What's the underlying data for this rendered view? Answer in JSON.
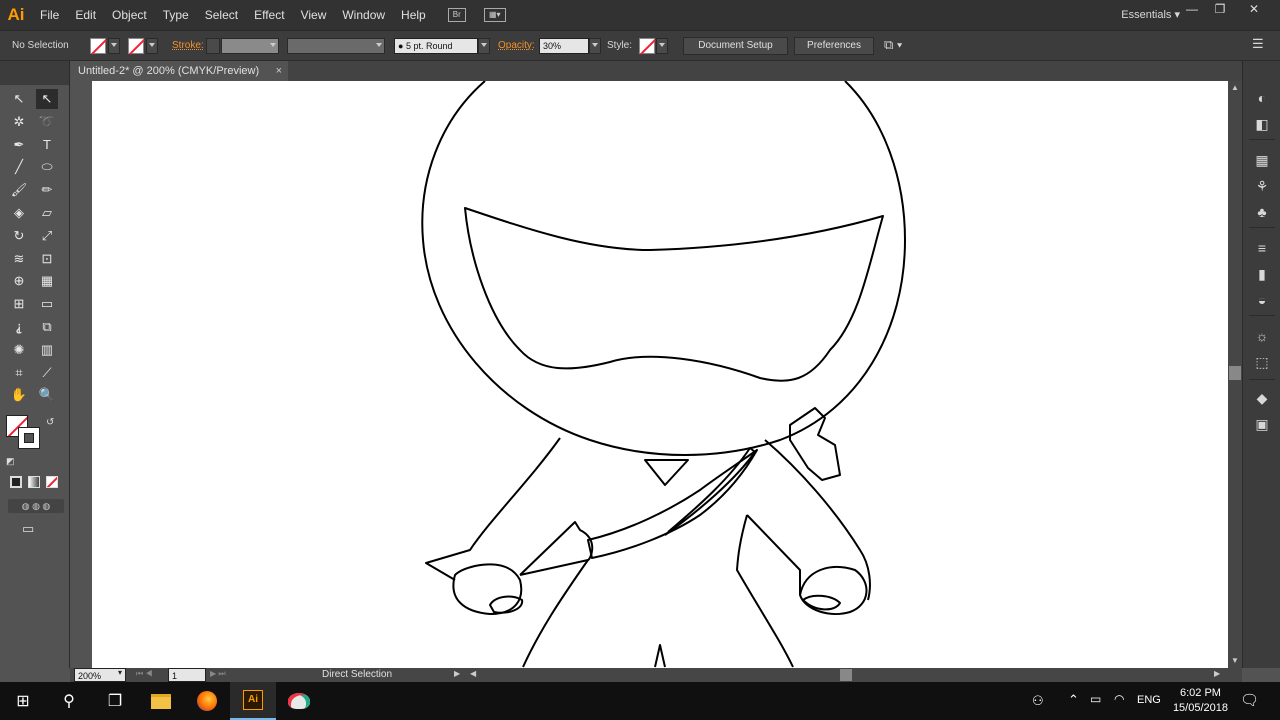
{
  "app": {
    "logo": "Ai",
    "workspace": "Essentials"
  },
  "menu": [
    "File",
    "Edit",
    "Object",
    "Type",
    "Select",
    "Effect",
    "View",
    "Window",
    "Help"
  ],
  "menubar_icons": {
    "bridge": "Br"
  },
  "window_controls": {
    "minimize": "—",
    "restore": "❐",
    "close": "✕"
  },
  "control_bar": {
    "selection_label": "No Selection",
    "stroke_label": "Stroke:",
    "brush_value": "5 pt. Round",
    "opacity_label": "Opacity:",
    "opacity_value": "30%",
    "style_label": "Style:",
    "document_setup": "Document Setup",
    "preferences": "Preferences"
  },
  "document": {
    "tab_title": "Untitled-2* @ 200% (CMYK/Preview)",
    "close": "×"
  },
  "tools": [
    {
      "icon": "selection-tool-icon",
      "glyph": "↖"
    },
    {
      "icon": "direct-selection-tool-icon",
      "glyph": "↖"
    },
    {
      "icon": "magic-wand-tool-icon",
      "glyph": "✲"
    },
    {
      "icon": "lasso-tool-icon",
      "glyph": "➰"
    },
    {
      "icon": "pen-tool-icon",
      "glyph": "✒"
    },
    {
      "icon": "type-tool-icon",
      "glyph": "T"
    },
    {
      "icon": "line-tool-icon",
      "glyph": "╱"
    },
    {
      "icon": "ellipse-tool-icon",
      "glyph": "⬭"
    },
    {
      "icon": "paintbrush-tool-icon",
      "glyph": "🖌"
    },
    {
      "icon": "pencil-tool-icon",
      "glyph": "✏"
    },
    {
      "icon": "shaper-tool-icon",
      "glyph": "◈"
    },
    {
      "icon": "eraser-tool-icon",
      "glyph": "▱"
    },
    {
      "icon": "rotate-tool-icon",
      "glyph": "↻"
    },
    {
      "icon": "scale-tool-icon",
      "glyph": "⤢"
    },
    {
      "icon": "warp-tool-icon",
      "glyph": "≋"
    },
    {
      "icon": "free-transform-tool-icon",
      "glyph": "⊡"
    },
    {
      "icon": "shape-builder-tool-icon",
      "glyph": "⊕"
    },
    {
      "icon": "perspective-grid-tool-icon",
      "glyph": "▦"
    },
    {
      "icon": "mesh-tool-icon",
      "glyph": "⊞"
    },
    {
      "icon": "gradient-tool-icon",
      "glyph": "▭"
    },
    {
      "icon": "eyedropper-tool-icon",
      "glyph": "⸘"
    },
    {
      "icon": "blend-tool-icon",
      "glyph": "⧉"
    },
    {
      "icon": "symbol-sprayer-tool-icon",
      "glyph": "✺"
    },
    {
      "icon": "column-graph-tool-icon",
      "glyph": "▥"
    },
    {
      "icon": "artboard-tool-icon",
      "glyph": "⌗"
    },
    {
      "icon": "slice-tool-icon",
      "glyph": "⟋"
    },
    {
      "icon": "hand-tool-icon",
      "glyph": "✋"
    },
    {
      "icon": "zoom-tool-icon",
      "glyph": "🔍"
    }
  ],
  "status_bar": {
    "zoom": "200%",
    "artboard": "1",
    "current_tool": "Direct Selection"
  },
  "right_dock": [
    "color-panel-icon",
    "color-guide-icon",
    "swatches-icon",
    "brushes-icon",
    "symbols-icon",
    "stroke-icon",
    "gradient-icon",
    "transparency-icon",
    "appearance-icon",
    "graphic-styles-icon",
    "layers-icon",
    "artboards-icon"
  ],
  "taskbar": {
    "time": "6:02 PM",
    "date": "15/05/2018",
    "language": "ENG",
    "apps": [
      "start-icon",
      "search-icon",
      "task-view-icon",
      "file-explorer-icon",
      "firefox-icon",
      "illustrator-icon",
      "paint-icon"
    ]
  },
  "colors": {
    "orange_label": "#f1922a",
    "ai_brand": "#ff9a00",
    "taskbar_accent": "#76b9ed"
  }
}
